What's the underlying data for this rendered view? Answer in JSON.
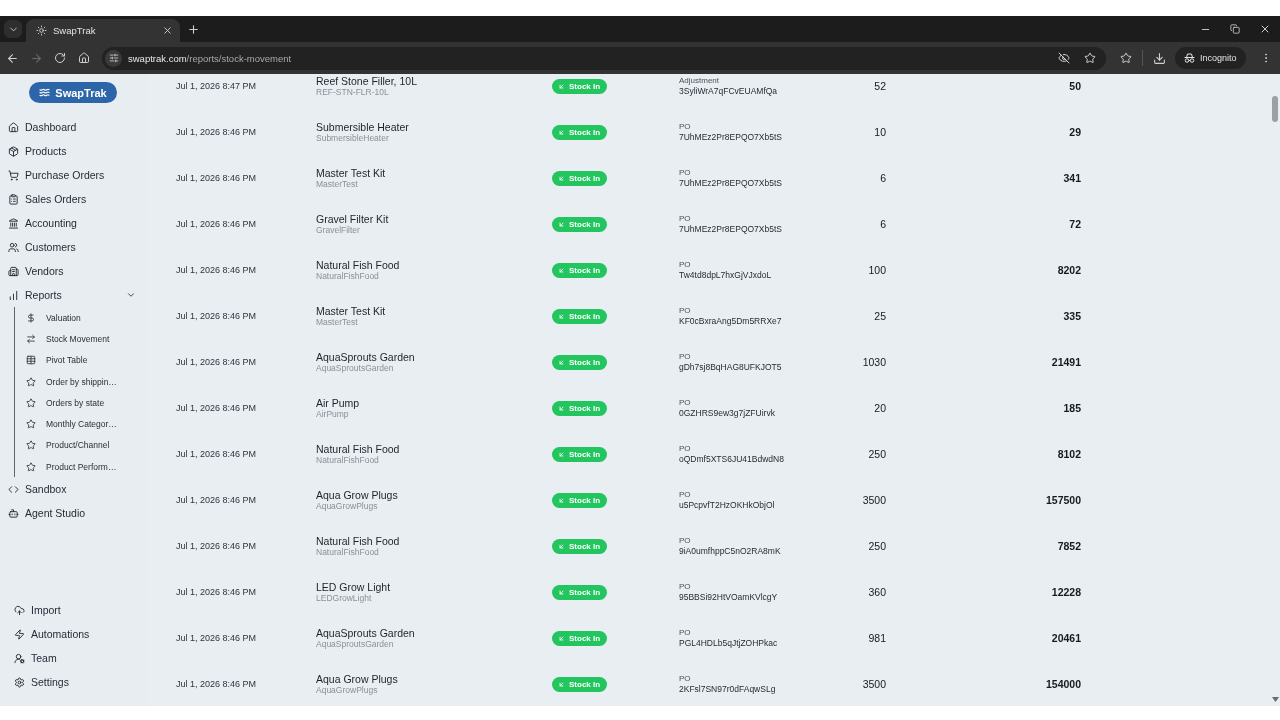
{
  "browser": {
    "tab_title": "SwapTrak",
    "url_host": "swaptrak.com",
    "url_path": "/reports/stock-movement",
    "forward_disabled": true,
    "profile": "Incognito"
  },
  "sidebar": {
    "brand": "SwapTrak",
    "main_nav": [
      {
        "label": "Dashboard"
      },
      {
        "label": "Products"
      },
      {
        "label": "Purchase Orders"
      },
      {
        "label": "Sales Orders"
      },
      {
        "label": "Accounting"
      },
      {
        "label": "Customers"
      },
      {
        "label": "Vendors"
      },
      {
        "label": "Reports",
        "expanded": true,
        "children": [
          {
            "label": "Valuation"
          },
          {
            "label": "Stock Movement"
          },
          {
            "label": "Pivot Table"
          },
          {
            "label": "Order by shippin…"
          },
          {
            "label": "Orders by state"
          },
          {
            "label": "Monthly Categor…"
          },
          {
            "label": "Product/Channel"
          },
          {
            "label": "Product Perform…"
          }
        ]
      },
      {
        "label": "Sandbox"
      },
      {
        "label": "Agent Studio"
      }
    ],
    "footer_nav": [
      {
        "label": "Import"
      },
      {
        "label": "Automations"
      },
      {
        "label": "Team"
      },
      {
        "label": "Settings"
      }
    ]
  },
  "table": {
    "rows": [
      {
        "date": "Jul 1, 2026 8:47 PM",
        "product": "Reef Stone Filler, 10L",
        "sku": "REF-STN-FLR-10L",
        "movement": "Stock In",
        "reference_type": "Adjustment",
        "reference": "3SyliWrA7qFCvEUAMfQa",
        "quantity": "52",
        "balance": "50"
      },
      {
        "date": "Jul 1, 2026 8:46 PM",
        "product": "Submersible Heater",
        "sku": "SubmersibleHeater",
        "movement": "Stock In",
        "reference_type": "PO",
        "reference": "7UhMEz2Pr8EPQO7Xb5tS",
        "quantity": "10",
        "balance": "29"
      },
      {
        "date": "Jul 1, 2026 8:46 PM",
        "product": "Master Test Kit",
        "sku": "MasterTest",
        "movement": "Stock In",
        "reference_type": "PO",
        "reference": "7UhMEz2Pr8EPQO7Xb5tS",
        "quantity": "6",
        "balance": "341"
      },
      {
        "date": "Jul 1, 2026 8:46 PM",
        "product": "Gravel Filter Kit",
        "sku": "GravelFilter",
        "movement": "Stock In",
        "reference_type": "PO",
        "reference": "7UhMEz2Pr8EPQO7Xb5tS",
        "quantity": "6",
        "balance": "72"
      },
      {
        "date": "Jul 1, 2026 8:46 PM",
        "product": "Natural Fish Food",
        "sku": "NaturalFishFood",
        "movement": "Stock In",
        "reference_type": "PO",
        "reference": "Tw4td8dpL7hxGjVJxdoL",
        "quantity": "100",
        "balance": "8202"
      },
      {
        "date": "Jul 1, 2026 8:46 PM",
        "product": "Master Test Kit",
        "sku": "MasterTest",
        "movement": "Stock In",
        "reference_type": "PO",
        "reference": "KF0cBxraAng5Dm5RRXe7",
        "quantity": "25",
        "balance": "335"
      },
      {
        "date": "Jul 1, 2026 8:46 PM",
        "product": "AquaSprouts Garden",
        "sku": "AquaSproutsGarden",
        "movement": "Stock In",
        "reference_type": "PO",
        "reference": "gDh7sj8BqHAG8UFKJOT5",
        "quantity": "1030",
        "balance": "21491"
      },
      {
        "date": "Jul 1, 2026 8:46 PM",
        "product": "Air Pump",
        "sku": "AirPump",
        "movement": "Stock In",
        "reference_type": "PO",
        "reference": "0GZHRS9ew3g7jZFUirvk",
        "quantity": "20",
        "balance": "185"
      },
      {
        "date": "Jul 1, 2026 8:46 PM",
        "product": "Natural Fish Food",
        "sku": "NaturalFishFood",
        "movement": "Stock In",
        "reference_type": "PO",
        "reference": "oQDmf5XTS6JU41BdwdN8",
        "quantity": "250",
        "balance": "8102"
      },
      {
        "date": "Jul 1, 2026 8:46 PM",
        "product": "Aqua Grow Plugs",
        "sku": "AquaGrowPlugs",
        "movement": "Stock In",
        "reference_type": "PO",
        "reference": "u5PcpvfT2HzOKHkObjOl",
        "quantity": "3500",
        "balance": "157500"
      },
      {
        "date": "Jul 1, 2026 8:46 PM",
        "product": "Natural Fish Food",
        "sku": "NaturalFishFood",
        "movement": "Stock In",
        "reference_type": "PO",
        "reference": "9iA0umfhppC5nO2RA8mK",
        "quantity": "250",
        "balance": "7852"
      },
      {
        "date": "Jul 1, 2026 8:46 PM",
        "product": "LED Grow Light",
        "sku": "LEDGrowLight",
        "movement": "Stock In",
        "reference_type": "PO",
        "reference": "95BBSi92HtVOamKVlcgY",
        "quantity": "360",
        "balance": "12228"
      },
      {
        "date": "Jul 1, 2026 8:46 PM",
        "product": "AquaSprouts Garden",
        "sku": "AquaSproutsGarden",
        "movement": "Stock In",
        "reference_type": "PO",
        "reference": "PGL4HDLb5qJtjZOHPkac",
        "quantity": "981",
        "balance": "20461"
      },
      {
        "date": "Jul 1, 2026 8:46 PM",
        "product": "Aqua Grow Plugs",
        "sku": "AquaGrowPlugs",
        "movement": "Stock In",
        "reference_type": "PO",
        "reference": "2KFsl7SN97r0dFAqwSLg",
        "quantity": "3500",
        "balance": "154000"
      }
    ]
  }
}
